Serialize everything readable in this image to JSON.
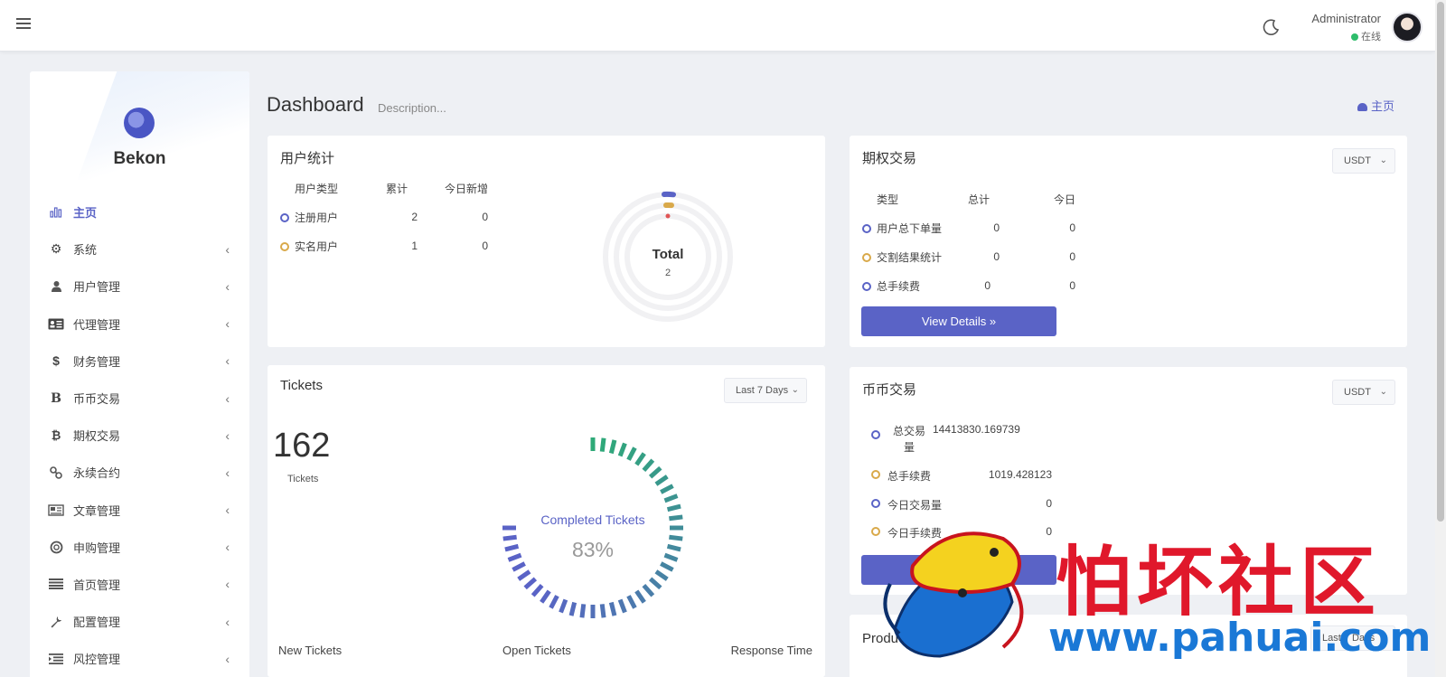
{
  "header": {
    "user_name": "Administrator",
    "user_status": "在线"
  },
  "brand": {
    "name": "Bekon"
  },
  "sidebar": {
    "items": [
      {
        "label": "主页",
        "icon": "bar-chart-icon",
        "active": true
      },
      {
        "label": "系统",
        "icon": "gear-icon"
      },
      {
        "label": "用户管理",
        "icon": "user-icon"
      },
      {
        "label": "代理管理",
        "icon": "id-card-icon"
      },
      {
        "label": "财务管理",
        "icon": "dollar-icon"
      },
      {
        "label": "币币交易",
        "icon": "bold-b-icon"
      },
      {
        "label": "期权交易",
        "icon": "bitcoin-icon"
      },
      {
        "label": "永续合约",
        "icon": "link-icon"
      },
      {
        "label": "文章管理",
        "icon": "newspaper-icon"
      },
      {
        "label": "申购管理",
        "icon": "lifebuoy-icon"
      },
      {
        "label": "首页管理",
        "icon": "list-icon"
      },
      {
        "label": "配置管理",
        "icon": "wrench-icon"
      },
      {
        "label": "风控管理",
        "icon": "indent-icon"
      }
    ]
  },
  "page": {
    "title": "Dashboard",
    "description": "Description...",
    "breadcrumb": "主页"
  },
  "user_stats": {
    "title": "用户统计",
    "headers": [
      "用户类型",
      "累计",
      "今日新增"
    ],
    "rows": [
      {
        "label": "注册用户",
        "total": "2",
        "today": "0",
        "color": "#5a63c6"
      },
      {
        "label": "实名用户",
        "total": "1",
        "today": "0",
        "color": "#d9a94a"
      }
    ],
    "chart_label": "Total",
    "chart_value": "2"
  },
  "options_trade": {
    "title": "期权交易",
    "currency": "USDT",
    "headers": [
      "类型",
      "总计",
      "今日"
    ],
    "rows": [
      {
        "label": "用户总下单量",
        "total": "0",
        "today": "0",
        "color": "#5a63c6"
      },
      {
        "label": "交割结果统计",
        "total": "0",
        "today": "0",
        "color": "#d9a94a"
      },
      {
        "label": "总手续费",
        "total": "0",
        "today": "0",
        "color": "#5a63c6"
      }
    ],
    "button": "View Details »"
  },
  "tickets": {
    "title": "Tickets",
    "range": "Last 7 Days",
    "count": "162",
    "count_label": "Tickets",
    "gauge_label": "Completed Tickets",
    "gauge_value": "83%",
    "gauge_fraction": 0.83,
    "footer": [
      "New Tickets",
      "Open Tickets",
      "Response Time"
    ]
  },
  "spot_trade": {
    "title": "币币交易",
    "currency": "USDT",
    "rows": [
      {
        "label": "总交易量",
        "value": "14413830.169739",
        "color": "#5a63c6"
      },
      {
        "label": "总手续费",
        "value": "1019.428123",
        "color": "#d9a94a"
      },
      {
        "label": "今日交易量",
        "value": "0",
        "color": "#5a63c6"
      },
      {
        "label": "今日手续费",
        "value": "0",
        "color": "#d9a94a"
      }
    ]
  },
  "products": {
    "title": "Produ",
    "range": "Last 7 Days"
  },
  "watermark": {
    "text": "怕坏社区",
    "url": "www.pahuai.com"
  }
}
